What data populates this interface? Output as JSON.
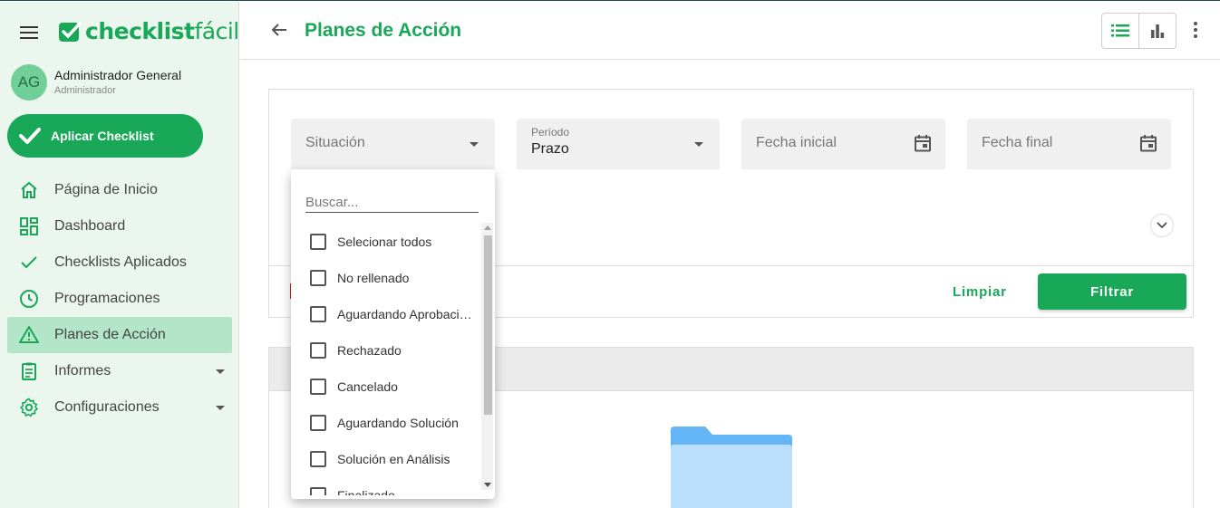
{
  "brand": {
    "logo_bold": "checklist",
    "logo_thin": "fácil"
  },
  "user": {
    "initials": "AG",
    "name": "Administrador General",
    "role": "Administrador"
  },
  "sidebar": {
    "apply_button": "Aplicar Checklist",
    "items": [
      {
        "label": "Página de Inicio",
        "icon": "home-icon"
      },
      {
        "label": "Dashboard",
        "icon": "dashboard-icon"
      },
      {
        "label": "Checklists Aplicados",
        "icon": "check-icon"
      },
      {
        "label": "Programaciones",
        "icon": "clock-icon"
      },
      {
        "label": "Planes de Acción",
        "icon": "warning-icon",
        "active": true
      },
      {
        "label": "Informes",
        "icon": "report-icon",
        "expandable": true
      },
      {
        "label": "Configuraciones",
        "icon": "gear-icon",
        "expandable": true
      }
    ]
  },
  "header": {
    "title": "Planes de Acción"
  },
  "filters": {
    "situacion": {
      "placeholder": "Situación"
    },
    "periodo": {
      "label": "Período",
      "value": "Prazo"
    },
    "fecha_inicial": {
      "placeholder": "Fecha inicial"
    },
    "fecha_final": {
      "placeholder": "Fecha final"
    },
    "clear_label": "Limpiar",
    "filter_label": "Filtrar"
  },
  "dropdown": {
    "search_placeholder": "Buscar...",
    "options": [
      "Selecionar todos",
      "No rellenado",
      "Aguardando Aprobación",
      "Rechazado",
      "Cancelado",
      "Aguardando Solución",
      "Solución en Análisis",
      "Finalizado"
    ]
  },
  "colors": {
    "brand": "#19a857",
    "active_nav": "#b3e5c8",
    "sidebar_bg": "#ebf6ef"
  }
}
